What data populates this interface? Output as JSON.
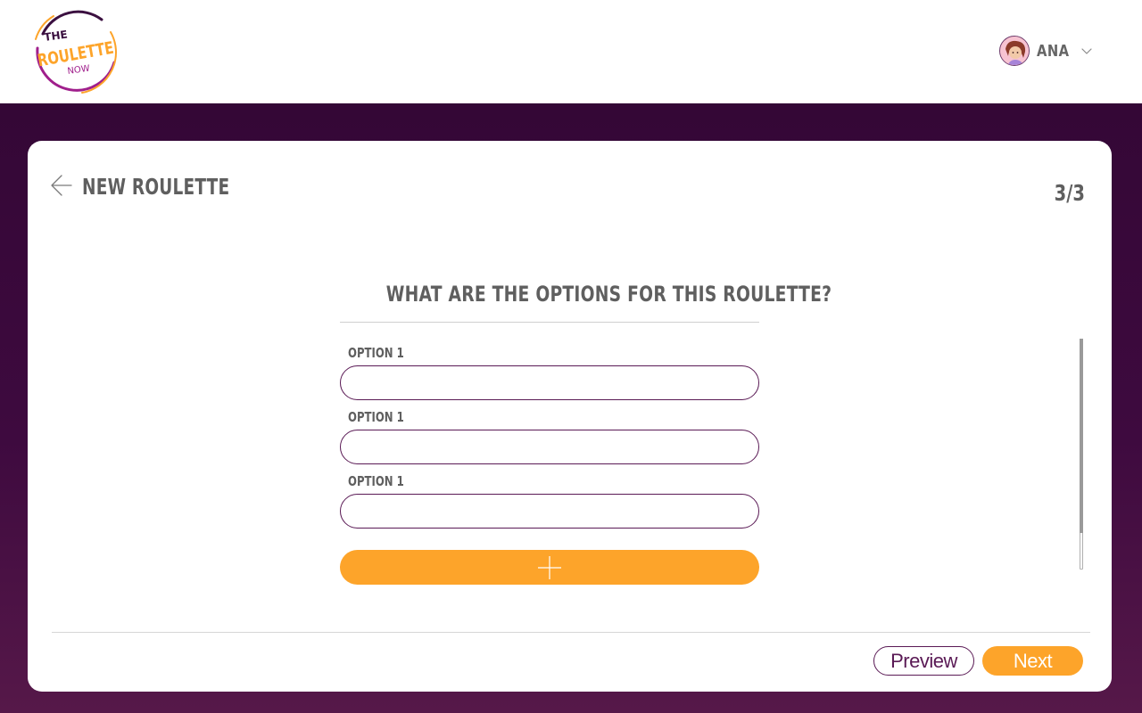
{
  "header": {
    "logo": {
      "line1": "THE",
      "line2": "ROULETTE",
      "line3": "NOW"
    },
    "user": {
      "name": "ANA",
      "avatar_icon": "avatar-icon",
      "dropdown_icon": "chevron-down-icon"
    }
  },
  "card": {
    "title": "NEW ROULETTE",
    "back_icon": "arrow-left-icon",
    "step": "3/3",
    "question": "WHAT ARE THE OPTIONS FOR THIS ROULETTE?",
    "options": [
      {
        "label": "OPTION 1",
        "value": "",
        "placeholder": ""
      },
      {
        "label": "OPTION 1",
        "value": "",
        "placeholder": ""
      },
      {
        "label": "OPTION 1",
        "value": "",
        "placeholder": ""
      }
    ],
    "add_option_icon": "plus-icon",
    "buttons": {
      "preview": "Preview",
      "next": "Next"
    }
  },
  "colors": {
    "brand_orange": "#fda42a",
    "brand_purple": "#5a1a55",
    "backdrop_purple": "#340736",
    "text_gray": "#5f5f5f"
  }
}
